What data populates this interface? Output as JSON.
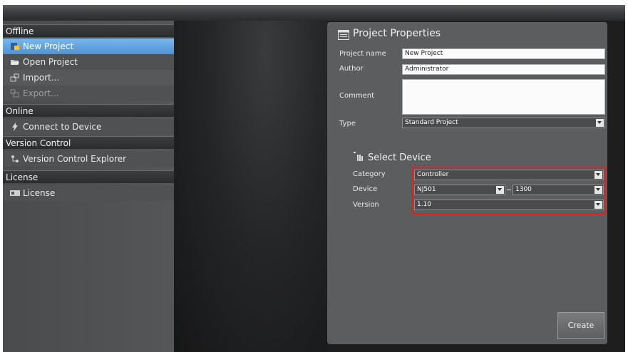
{
  "sidebar": {
    "groups": [
      {
        "label": "Offline"
      },
      {
        "label": "Online"
      },
      {
        "label": "Version Control"
      },
      {
        "label": "License"
      }
    ],
    "items": [
      {
        "label": "New Project",
        "icon": "new-project-icon",
        "state": "selected"
      },
      {
        "label": "Open Project",
        "icon": "folder-open-icon"
      },
      {
        "label": "Import...",
        "icon": "import-icon"
      },
      {
        "label": "Export...",
        "icon": "export-icon",
        "state": "disabled"
      },
      {
        "label": "Connect to Device",
        "icon": "lightning-icon"
      },
      {
        "label": "Version Control Explorer",
        "icon": "version-control-icon"
      },
      {
        "label": "License",
        "icon": "license-icon"
      }
    ]
  },
  "properties": {
    "title": "Project Properties",
    "project_name_label": "Project name",
    "project_name_value": "New Project",
    "author_label": "Author",
    "author_value": "Administrator",
    "comment_label": "Comment",
    "comment_value": "",
    "type_label": "Type",
    "type_value": "Standard Project"
  },
  "device": {
    "title": "Select Device",
    "category_label": "Category",
    "category_value": "Controller",
    "device_label": "Device",
    "device_series_value": "NJ501",
    "device_model_value": "1300",
    "version_label": "Version",
    "version_value": "1.10"
  },
  "actions": {
    "create_label": "Create"
  },
  "colors": {
    "selected": "#5a9ed9",
    "highlight_box": "#e0221f",
    "panel": "#5c5d5f"
  }
}
